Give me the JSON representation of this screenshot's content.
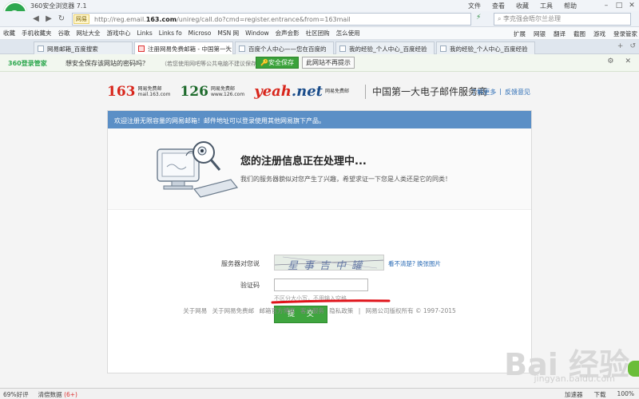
{
  "window": {
    "title": "360安全浏览器 7.1",
    "menu": [
      "文件",
      "查看",
      "收藏",
      "工具",
      "帮助"
    ]
  },
  "nav": {
    "site_badge": "网易",
    "url_prefix": "http://reg.email.",
    "url_domain": "163.com",
    "url_suffix": "/unireg/call.do?cmd=register.entrance&from=163mail",
    "search_text": "李克强会晤尔兰总理"
  },
  "bookmarks": {
    "items": [
      "收藏",
      "手机收藏夹",
      "谷歌",
      "网址大全",
      "游戏中心",
      "Links",
      "Links fo",
      "Microso",
      "MSN 网",
      "Window",
      "会声会影",
      "社区团购",
      "怎么使用"
    ],
    "right": [
      "扩展",
      "网银",
      "翻译",
      "截图",
      "游戏",
      "登录管家"
    ]
  },
  "tabs": [
    {
      "label": "网易邮箱_百度搜索",
      "active": false
    },
    {
      "label": "注册网易免费邮箱 - 中国第一大",
      "active": true
    },
    {
      "label": "百度个人中心——您在百度的",
      "active": false
    },
    {
      "label": "我的经验_个人中心_百度经验",
      "active": false
    },
    {
      "label": "我的经验_个人中心_百度经验",
      "active": false
    }
  ],
  "password_bar": {
    "brand": "360登录管家",
    "question": "想安全保存该网站的密码吗？",
    "note": "（若您使用网吧等公共电脑不建议保存）",
    "save_label": "安全保存",
    "nomore_label": "此网站不再提示"
  },
  "page": {
    "logo_163": "163",
    "logo_163_sub1": "网易免费邮",
    "logo_163_sub2": "mail.163.com",
    "logo_126": "126",
    "logo_126_sub1": "网易免费邮",
    "logo_126_sub2": "www.126.com",
    "logo_yeah": "yeah",
    "logo_yeah_net": ".net",
    "logo_yeah_sub": "网易免费邮",
    "slogan": "中国第一大电子邮件服务商",
    "link_more": "了解更多",
    "link_sep": "|",
    "link_feedback": "反馈意见",
    "banner": "欢迎注册无限容量的网易邮箱！邮件地址可以登录使用其他网易旗下产品。",
    "processing_title": "您的注册信息正在处理中...",
    "processing_desc": "我们的服务器貌似对您产生了兴趣，希望求证一下您是人类还是它的同类！",
    "captcha_label": "服务器对您说",
    "captcha_text": "星事吉中罐",
    "captcha_help_1": "看不清楚?",
    "captcha_help_2": "换张图片",
    "code_label": "验证码",
    "code_value": "",
    "code_hint": "不区分大小写，不用输入空格",
    "submit_label": "提 交",
    "footer_links": [
      "关于网易",
      "关于网易免费邮",
      "邮箱官方博客",
      "客户服务",
      "隐私政策"
    ],
    "footer_sep": "|",
    "copyright": "网易公司版权所有 © 1997-2015"
  },
  "watermark": {
    "main": "Bai  经验",
    "sub": "jingyan.baidu.com"
  },
  "status": {
    "rating": "69%好评",
    "cleanup": "清偿数据",
    "cleanup_count": "(6+)",
    "right": [
      "加速器",
      "下载",
      "100%"
    ]
  }
}
